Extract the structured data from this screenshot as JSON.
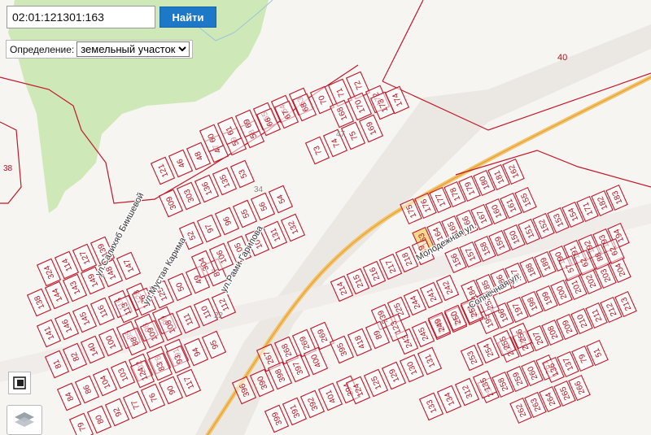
{
  "search": {
    "value": "02:01:121301:163",
    "button_label": "Найти"
  },
  "definition": {
    "label": "Определение:",
    "selected": "земельный участок",
    "options": [
      "земельный участок"
    ]
  },
  "colors": {
    "background": "#f7f5f2",
    "forest": "#cfe8b8",
    "parcel_border": "#c0182a",
    "parcel_label": "#b01020",
    "highlight": "#f6d98a",
    "road": "#f1c36a",
    "button": "#1e78c8"
  },
  "map": {
    "streets": [
      "ул.Салихяб Биишевой",
      "ул.Мустая Карима",
      "ул.Рами Гарипова",
      "Молодежная ул.",
      "Солнечная ул."
    ],
    "block_numbers": [
      "40",
      "47",
      "34",
      "22",
      "38"
    ],
    "highlighted_parcel": "163",
    "parcel_numbers": [
      "324",
      "114",
      "127",
      "139",
      "138",
      "144",
      "143",
      "149",
      "148",
      "147",
      "141",
      "146",
      "145",
      "116",
      "115",
      "128",
      "81",
      "82",
      "140",
      "100",
      "85",
      "98",
      "99",
      "84",
      "86",
      "104",
      "103",
      "102",
      "78",
      "91",
      "79",
      "80",
      "92",
      "77",
      "76",
      "90",
      "117",
      "113",
      "126",
      "125",
      "50",
      "49",
      "87",
      "88",
      "109",
      "108",
      "111",
      "110",
      "112",
      "124",
      "83",
      "93",
      "94",
      "95",
      "309",
      "303",
      "136",
      "135",
      "53",
      "52",
      "97",
      "96",
      "55",
      "56",
      "54",
      "304",
      "106",
      "105",
      "107",
      "131",
      "132",
      "121",
      "46",
      "48",
      "47",
      "59",
      "58",
      "60",
      "61",
      "69",
      "65",
      "64",
      "63",
      "66",
      "67",
      "68",
      "70",
      "71",
      "72",
      "73",
      "74",
      "75",
      "169",
      "168",
      "170",
      "172",
      "173",
      "174",
      "175",
      "176",
      "177",
      "178",
      "179",
      "180",
      "181",
      "162",
      "163",
      "164",
      "165",
      "166",
      "167",
      "160",
      "161",
      "155",
      "156",
      "157",
      "158",
      "159",
      "150",
      "151",
      "152",
      "153",
      "154",
      "171",
      "182",
      "183",
      "184",
      "185",
      "186",
      "187",
      "188",
      "189",
      "190",
      "191",
      "192",
      "193",
      "194",
      "195",
      "196",
      "197",
      "198",
      "199",
      "200",
      "201",
      "202",
      "203",
      "204",
      "205",
      "206",
      "207",
      "208",
      "209",
      "210",
      "211",
      "212",
      "213",
      "214",
      "215",
      "216",
      "217",
      "218",
      "219",
      "239",
      "225",
      "244",
      "241",
      "242",
      "243",
      "245",
      "246",
      "247",
      "248",
      "249",
      "250",
      "251",
      "252",
      "253",
      "254",
      "255",
      "256",
      "257",
      "258",
      "259",
      "260",
      "261",
      "262",
      "263",
      "264",
      "265",
      "266",
      "267",
      "268",
      "269",
      "269",
      "396",
      "390",
      "398",
      "397",
      "400",
      "399",
      "391",
      "392",
      "401",
      "394",
      "395",
      "418",
      "89",
      "123",
      "124",
      "125",
      "129",
      "130",
      "131",
      "133",
      "134",
      "312",
      "135",
      "136",
      "137",
      "79",
      "51",
      "57",
      "62",
      "88",
      "62"
    ]
  },
  "tools": {
    "parcel_tool_icon": "parcel-square-icon",
    "layers_icon": "layers-icon"
  }
}
